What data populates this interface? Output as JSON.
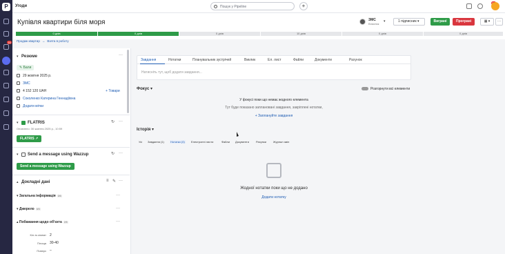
{
  "sidebar": {
    "logo": "P",
    "badge1": "16"
  },
  "topbar": {
    "title": "Угоди",
    "search_placeholder": "Пошук у Pipeline",
    "add_label": "+",
    "notif_badge": "50"
  },
  "header": {
    "deal_title": "Купівля квартири біля моря",
    "owner_name": "ЗМС",
    "owner_role": "Власник",
    "subscribers_label": "1 підписник",
    "won_label": "Виграні",
    "lost_label": "Програні",
    "more_label": "···"
  },
  "pipeline": {
    "stages": [
      {
        "label": "0 днів",
        "status": "done"
      },
      {
        "label": "0 днів",
        "status": "done"
      },
      {
        "label": "0 днів",
        "status": "todo"
      },
      {
        "label": "10 днів",
        "status": "todo"
      },
      {
        "label": "0 днів",
        "status": "todo"
      },
      {
        "label": "0 днів",
        "status": "todo"
      }
    ]
  },
  "breadcrumb": [
    "Продаж квартир",
    "→",
    "Взята в роботу"
  ],
  "summary": {
    "title": "Резюме",
    "tag": "Бали",
    "date": "29 жовтня 2025 р.",
    "org": "ЗМС",
    "amount": "4 152 120 UAH",
    "goods_label": "Товари",
    "person": "Соколенко Катерина Геннадіївна",
    "add_tags": "Додати мітки"
  },
  "flatris": {
    "title": "FLATRIS",
    "updated": "Оновлено: 30 жовтня 2025 р., 10:59",
    "button": "FLATRIS ↗"
  },
  "wazzup": {
    "title": "Send a message using Wazzup",
    "button": "Send a message using Wazzup"
  },
  "details": {
    "title": "Докладні дані",
    "sections": [
      {
        "label": "Загальна інформація",
        "count": "0/6"
      },
      {
        "label": "Джерело",
        "count": "0/3"
      },
      {
        "label": "Побажання щодо об'єкта",
        "count": "2/5"
      }
    ],
    "fields": [
      {
        "label": "Кіл-ть кімнат",
        "value": "2"
      },
      {
        "label": "Площа",
        "value": "30-40"
      },
      {
        "label": "Поверх",
        "value": "–"
      }
    ]
  },
  "activity": {
    "tabs": [
      "Завдання",
      "Нотатки",
      "Планувальник зустрічей",
      "Виклик",
      "Ел. лист",
      "Файли",
      "Документи",
      "Рахунок"
    ],
    "placeholder": "Натисніть тут, щоб додати завдання..."
  },
  "focus": {
    "title": "Фокус",
    "toggle_label": "Розгорнути всі елементи",
    "empty_title": "У фокусі поки що немає жодного елемента",
    "empty_sub": "Тут буде показано заплановані завдання, закріплені нотатки,",
    "schedule_link": "+ Заплануйте завдання"
  },
  "history": {
    "title": "Історія",
    "filters": [
      "Усі",
      "Завдання (1)",
      "Нотатки (0)",
      "Електронні листи",
      "Файли",
      "Документи",
      "Рахунки",
      "Журнал змін"
    ],
    "empty_title": "Жодної нотатки поки що не додано",
    "add_link": "Додати нотатку"
  },
  "colors": {
    "won": "#2e9b48",
    "lost": "#d9363e",
    "accent": "#1e5cb3",
    "sidebar": "#262742"
  }
}
